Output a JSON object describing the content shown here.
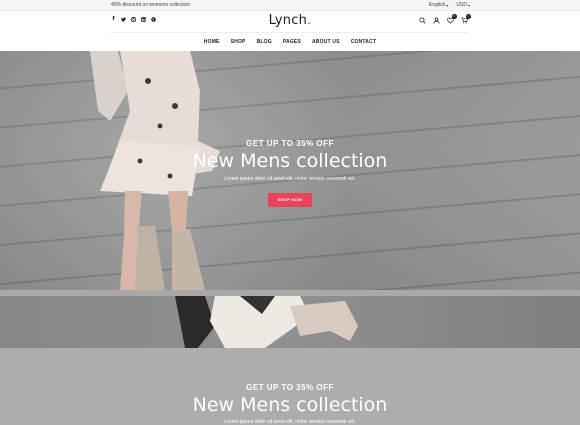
{
  "topbar": {
    "promo": "40% discount on womens collection",
    "language": "English",
    "currency": "USD"
  },
  "header": {
    "logo": "Lynch",
    "logo_dot": ".",
    "socials": [
      "facebook-icon",
      "twitter-icon",
      "instagram-icon",
      "linkedin-icon",
      "pinterest-icon"
    ],
    "wishlist_count": "0",
    "cart_count": "0"
  },
  "nav": {
    "items": [
      "HOME",
      "SHOP",
      "BLOG",
      "PAGES",
      "ABOUT US",
      "CONTACT"
    ]
  },
  "hero": {
    "subtitle": "GET UP TO 35% OFF",
    "title": "New Mens collection",
    "description": "Lorem ipsum dolor sit amet elit, nobis veniam commodi vel.",
    "button": "SHOP NOW",
    "accent_color": "#e8445a"
  },
  "hero2": {
    "subtitle": "GET UP TO 35% OFF",
    "title": "New Mens collection",
    "description": "Lorem ipsum dolor sit amet elit, nobis veniam commodi vel."
  }
}
